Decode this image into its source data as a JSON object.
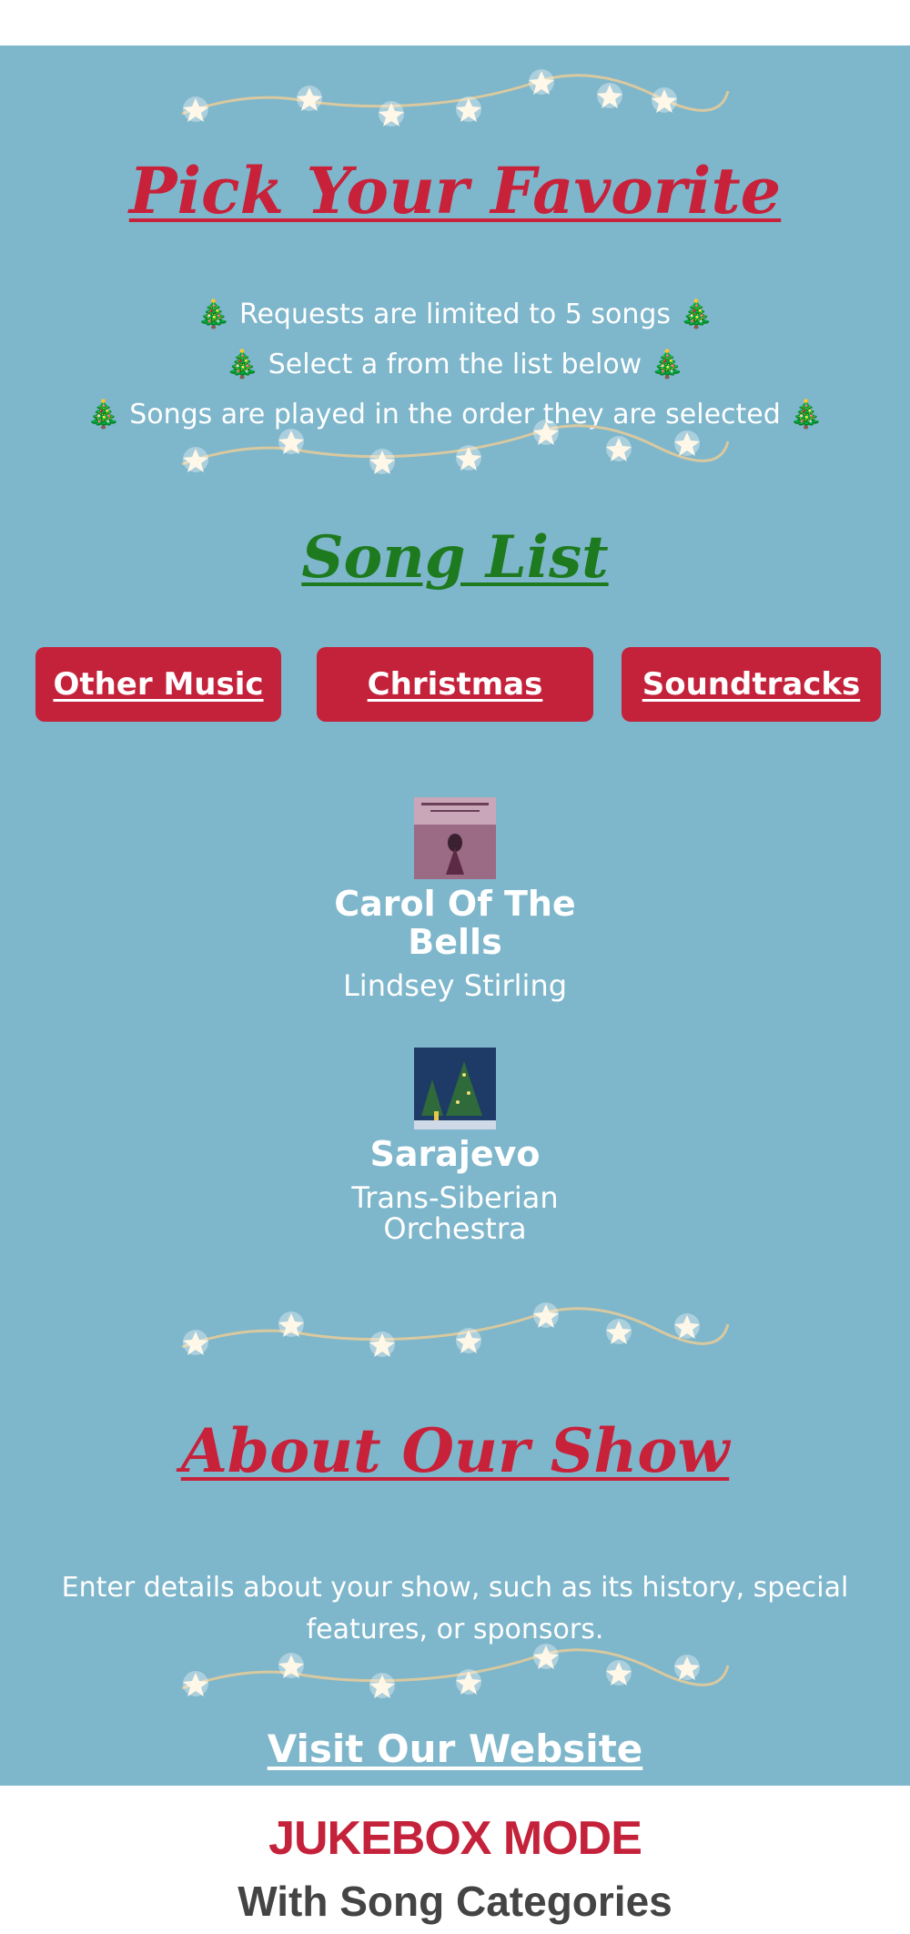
{
  "header": {
    "title": "Pick Your Favorite",
    "rules": [
      "Requests are limited to 5 songs",
      "Select a from the list below",
      "Songs are played in the order they are selected"
    ],
    "rule_icon": "🎄"
  },
  "song_list": {
    "title": "Song List",
    "categories": [
      "Other Music",
      "Christmas",
      "Soundtracks"
    ],
    "songs": [
      {
        "title": "Carol Of The Bells",
        "artist": "Lindsey Stirling"
      },
      {
        "title": "Sarajevo",
        "artist": "Trans-Siberian Orchestra"
      }
    ]
  },
  "about": {
    "title": "About Our Show",
    "text": "Enter details about your show, such as its history, special features, or sponsors."
  },
  "website_link": "Visit Our Website",
  "footer": {
    "brand": "JUKEBOX MODE",
    "subtitle": "With Song Categories"
  },
  "colors": {
    "panel_bg": "#7eb6cb",
    "accent_red": "#c4213a",
    "accent_green": "#1e7a1e",
    "footer_text": "#444444"
  }
}
